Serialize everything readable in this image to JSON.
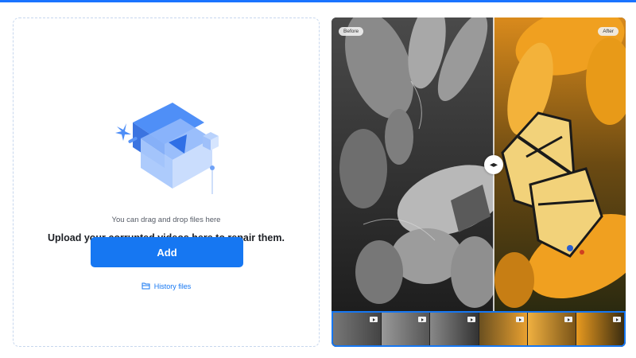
{
  "upload": {
    "drag_hint": "You can drag and drop files here",
    "title": "Upload your corrupted videos here to repair them.",
    "add_label": "Add",
    "history_label": "History files",
    "folder_icon": "folder-icon",
    "illustration_icon": "video-upload-illustration"
  },
  "preview": {
    "before_label": "Before",
    "after_label": "After",
    "divider_icon": "left-right-arrows-icon",
    "filmstrip_frames": 6,
    "filmstrip_frame_icon": "play-icon"
  },
  "colors": {
    "accent": "#1677f2",
    "top_bar": "#1a73ff",
    "dashed_border": "#c7d7ee",
    "after_orange": "#f0a020",
    "butterfly_yellow": "#f2d27a"
  }
}
